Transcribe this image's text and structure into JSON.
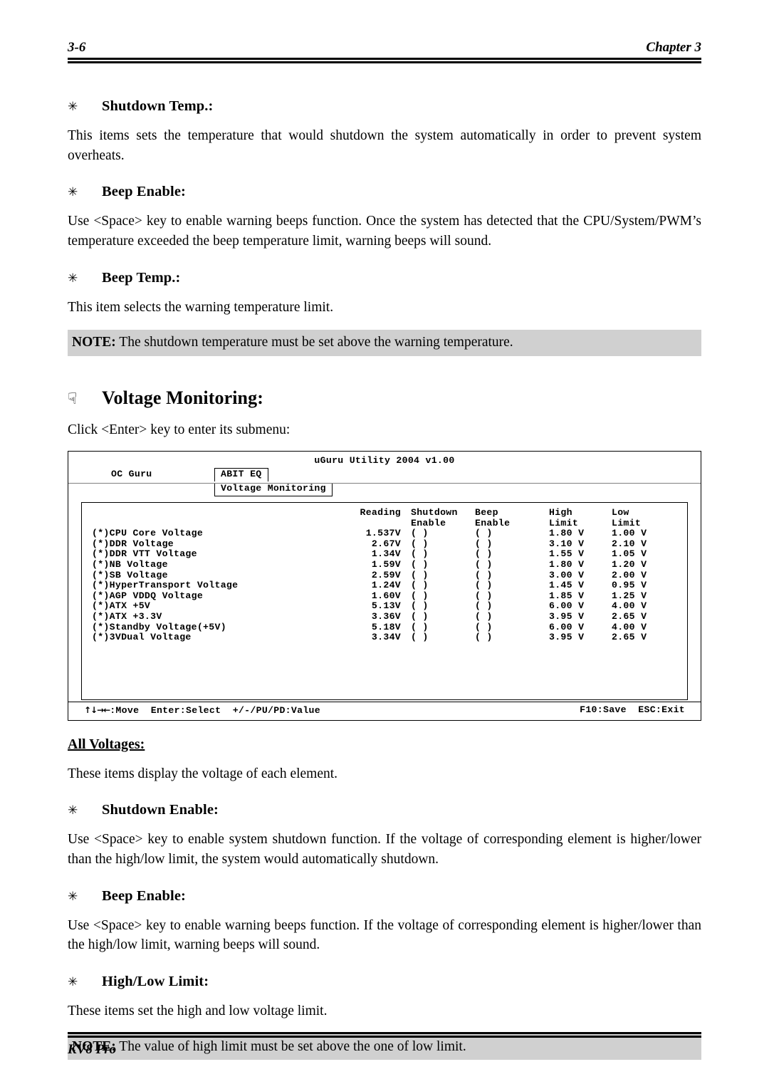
{
  "header": {
    "page_number": "3-6",
    "chapter": "Chapter 3"
  },
  "sections": {
    "shutdown_temp": {
      "bullet": "✳",
      "heading": "Shutdown Temp.:",
      "body": "This items sets the temperature that would shutdown the system automatically in order to prevent system overheats."
    },
    "beep_enable_1": {
      "bullet": "✳",
      "heading": "Beep Enable:",
      "body": "Use <Space> key to enable warning beeps function. Once the system has detected that the CPU/System/PWM’s temperature exceeded the beep temperature limit, warning beeps will sound."
    },
    "beep_temp": {
      "bullet": "✳",
      "heading": "Beep Temp.:",
      "body": "This item selects the warning temperature limit."
    },
    "note_1": {
      "prefix": "NOTE:",
      "text": " The shutdown temperature must be set above the warning temperature."
    },
    "voltage_monitoring": {
      "bullet": "☟",
      "heading": "Voltage Monitoring:",
      "body": "Click <Enter> key to enter its submenu:"
    },
    "all_voltages": {
      "heading": "All Voltages:",
      "body": "These items display the voltage of each element."
    },
    "shutdown_enable": {
      "bullet": "✳",
      "heading": "Shutdown Enable:",
      "body": "Use <Space> key to enable system shutdown function. If the voltage of corresponding element is higher/lower than the high/low limit, the system would automatically shutdown."
    },
    "beep_enable_2": {
      "bullet": "✳",
      "heading": "Beep Enable:",
      "body": "Use <Space> key to enable warning beeps function. If the voltage of corresponding element is higher/lower than the high/low limit, warning beeps will sound."
    },
    "high_low_limit": {
      "bullet": "✳",
      "heading": "High/Low Limit:",
      "body": "These items set the high and low voltage limit."
    },
    "note_2": {
      "prefix": "NOTE:",
      "text": " The value of high limit must be set above the one of low limit."
    }
  },
  "bios": {
    "title": "uGuru Utility 2004 v1.00",
    "tab_plain": "OC Guru",
    "tab_active": "ABIT EQ",
    "subtab_active": "Voltage Monitoring",
    "columns": {
      "label": "",
      "reading": "Reading",
      "shutdown_line1": "Shutdown",
      "shutdown_line2": "Enable",
      "beep_line1": "Beep",
      "beep_line2": "Enable",
      "high_line1": "High",
      "high_line2": "Limit",
      "low_line1": "Low",
      "low_line2": "Limit"
    },
    "checkbox_empty": "( )",
    "rows": [
      {
        "marker": "(*)",
        "label": "CPU Core Voltage",
        "reading": "1.537V",
        "shutdown": "( )",
        "beep": "( )",
        "high": "1.80 V",
        "low": "1.00 V"
      },
      {
        "marker": "(*)",
        "label": "DDR Voltage",
        "reading": "2.67V",
        "shutdown": "( )",
        "beep": "( )",
        "high": "3.10 V",
        "low": "2.10 V"
      },
      {
        "marker": "(*)",
        "label": "DDR VTT Voltage",
        "reading": "1.34V",
        "shutdown": "( )",
        "beep": "( )",
        "high": "1.55 V",
        "low": "1.05 V"
      },
      {
        "marker": "(*)",
        "label": "NB Voltage",
        "reading": "1.59V",
        "shutdown": "( )",
        "beep": "( )",
        "high": "1.80 V",
        "low": "1.20 V"
      },
      {
        "marker": "(*)",
        "label": "SB Voltage",
        "reading": "2.59V",
        "shutdown": "( )",
        "beep": "( )",
        "high": "3.00 V",
        "low": "2.00 V"
      },
      {
        "marker": "(*)",
        "label": "HyperTransport Voltage",
        "reading": "1.24V",
        "shutdown": "( )",
        "beep": "( )",
        "high": "1.45 V",
        "low": "0.95 V"
      },
      {
        "marker": "(*)",
        "label": "AGP VDDQ Voltage",
        "reading": "1.60V",
        "shutdown": "( )",
        "beep": "( )",
        "high": "1.85 V",
        "low": "1.25 V"
      },
      {
        "marker": "(*)",
        "label": "ATX +5V",
        "reading": "5.13V",
        "shutdown": "( )",
        "beep": "( )",
        "high": "6.00 V",
        "low": "4.00 V"
      },
      {
        "marker": "(*)",
        "label": "ATX +3.3V",
        "reading": "3.36V",
        "shutdown": "( )",
        "beep": "( )",
        "high": "3.95 V",
        "low": "2.65 V"
      },
      {
        "marker": "(*)",
        "label": "Standby Voltage(+5V)",
        "reading": "5.18V",
        "shutdown": "( )",
        "beep": "( )",
        "high": "6.00 V",
        "low": "4.00 V"
      },
      {
        "marker": "(*)",
        "label": "3VDual Voltage",
        "reading": "3.34V",
        "shutdown": "( )",
        "beep": "( )",
        "high": "3.95 V",
        "low": "2.65 V"
      }
    ],
    "footer": {
      "arrows": "↑↓→←",
      "move": ":Move",
      "select": "Enter:Select",
      "value": "+/-/PU/PD:Value",
      "save": "F10:Save",
      "exit": "ESC:Exit"
    }
  },
  "footer": {
    "product": "KV8 Pro"
  }
}
